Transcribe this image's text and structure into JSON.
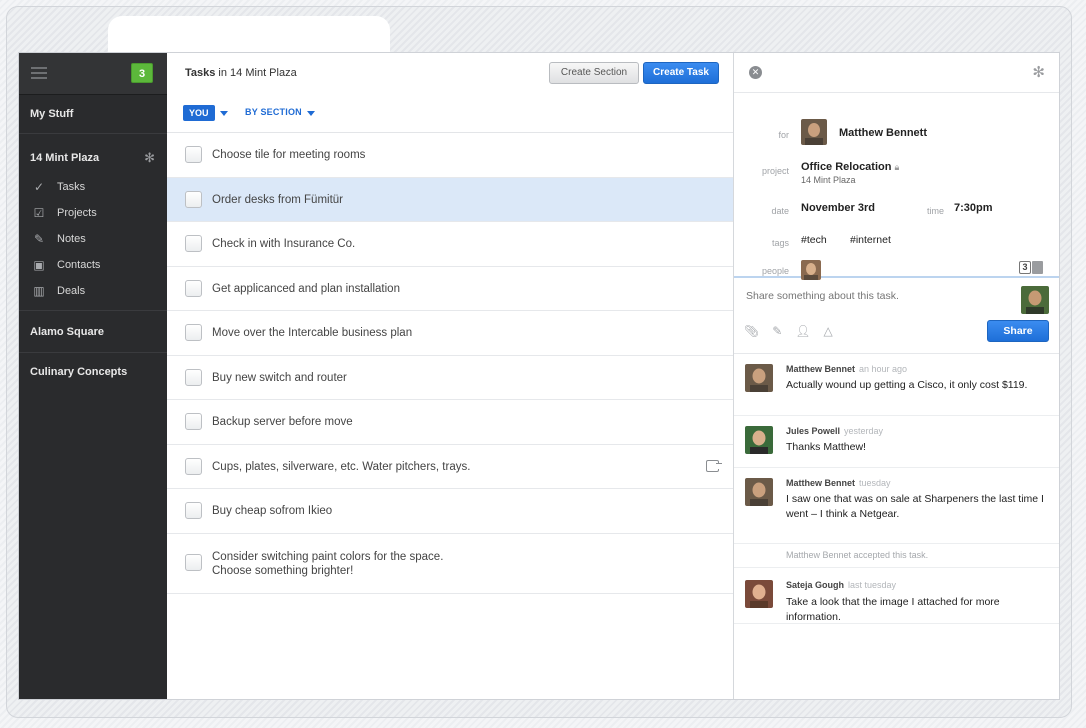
{
  "sidebar": {
    "badge_count": "3",
    "my_stuff": "My Stuff",
    "project": {
      "name": "14 Mint Plaza",
      "items": [
        {
          "label": "Tasks",
          "icon": "checkmark-icon"
        },
        {
          "label": "Projects",
          "icon": "checkbox-icon"
        },
        {
          "label": "Notes",
          "icon": "pencil-icon"
        },
        {
          "label": "Contacts",
          "icon": "contacts-icon"
        },
        {
          "label": "Deals",
          "icon": "bar-chart-icon"
        }
      ]
    },
    "other_projects": [
      "Alamo Square",
      "Culinary Concepts"
    ]
  },
  "tasks": {
    "title_prefix": "Tasks",
    "title_in": " in 14 Mint Plaza",
    "create_section_label": "Create Section",
    "create_task_label": "Create Task",
    "filter_you": "YOU",
    "filter_section": "BY SECTION",
    "items": [
      {
        "text": "Choose tile for meeting rooms"
      },
      {
        "text": "Order desks from Fümitür"
      },
      {
        "text": "Check in with Insurance Co."
      },
      {
        "text": "Get applicanced and plan installation"
      },
      {
        "text": "Move over the Intercable business plan"
      },
      {
        "text": "Buy new switch and router"
      },
      {
        "text": "Backup server before move"
      },
      {
        "text": "Cups, plates, silverware, etc. Water pitchers, trays."
      },
      {
        "text": "Buy cheap sofrom Ikieo"
      },
      {
        "text": "Consider switching paint colors for the space.\nChoose something brighter!"
      }
    ]
  },
  "detail": {
    "labels": {
      "for": "for",
      "project": "project",
      "date": "date",
      "time": "time",
      "tags": "tags",
      "people": "people"
    },
    "for_name": "Matthew Bennett",
    "project_name": "Office Relocation",
    "project_sub": "14 Mint Plaza",
    "date": "November 3rd",
    "time": "7:30pm",
    "tags": [
      "#tech",
      "#internet"
    ],
    "people_count": "3",
    "composer_placeholder": "Share something about this task.",
    "share_label": "Share",
    "comments": [
      {
        "name": "Matthew Bennet",
        "time": "an hour ago",
        "text": "Actually wound up getting a Cisco, it only cost $119."
      },
      {
        "name": "Jules Powell",
        "time": "yesterday",
        "text": "Thanks Matthew!"
      },
      {
        "name": "Matthew Bennet",
        "time": "tuesday",
        "text": "I saw one that was on sale at Sharpeners the last time I went – I think a Netgear."
      },
      {
        "system": "Matthew Bennet accepted this task."
      },
      {
        "name": "Sateja Gough",
        "time": "last tuesday",
        "text": "Take a look that the image I attached for more information."
      }
    ]
  },
  "colors": {
    "accent": "#1f6bd4",
    "badge": "#5cb83b",
    "sidebar": "#2a2b2d",
    "selected_row": "#dbe8f8"
  }
}
